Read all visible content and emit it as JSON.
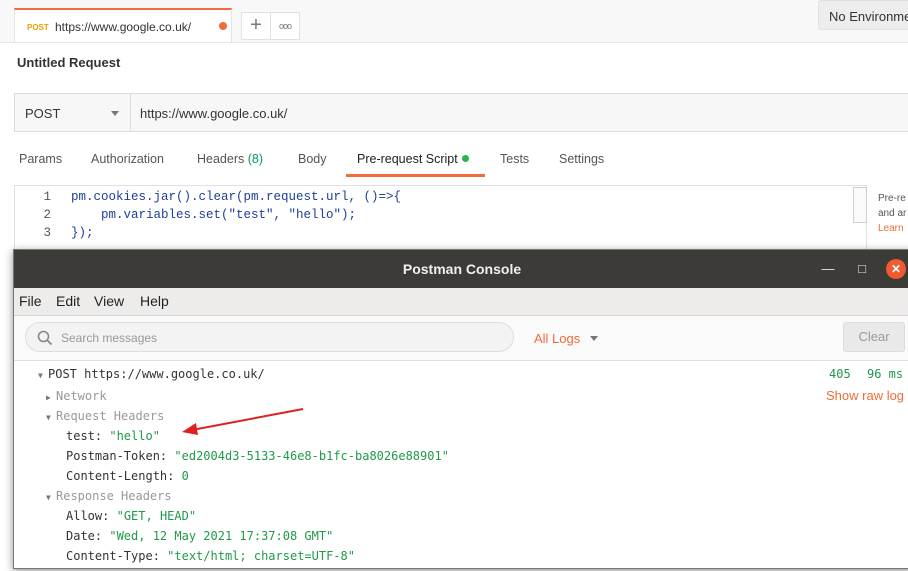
{
  "tab": {
    "method": "POST",
    "url": "https://www.google.co.uk/"
  },
  "tab_buttons": {
    "add": "+",
    "more": "ooo"
  },
  "environment": "No Environment",
  "request": {
    "title": "Untitled Request",
    "method": "POST",
    "url": "https://www.google.co.uk/"
  },
  "subtabs": [
    {
      "label": "Params"
    },
    {
      "label": "Authorization"
    },
    {
      "label": "Headers",
      "count": "(8)"
    },
    {
      "label": "Body"
    },
    {
      "label": "Pre-request Script"
    },
    {
      "label": "Tests"
    },
    {
      "label": "Settings"
    }
  ],
  "editor": {
    "lines": [
      {
        "num": "1",
        "code": "pm.cookies.jar().clear(pm.request.url, ()=>{"
      },
      {
        "num": "2",
        "code": "    pm.variables.set(\"test\", \"hello\");"
      },
      {
        "num": "3",
        "code": "});"
      }
    ]
  },
  "side_help": {
    "line1": "Pre-re",
    "line2": "and ar",
    "link": "Learn"
  },
  "console": {
    "title": "Postman Console",
    "menu": [
      "File",
      "Edit",
      "View",
      "Help"
    ],
    "search_placeholder": "Search messages",
    "filter": "All Logs",
    "clear": "Clear",
    "entry": {
      "summary": "POST https://www.google.co.uk/",
      "status": "405",
      "time": "96 ms",
      "raw_log": "Show raw log",
      "network": "Network",
      "request_headers_label": "Request Headers",
      "request_headers": [
        {
          "key": "test:",
          "value": "\"hello\""
        },
        {
          "key": "Postman-Token:",
          "value": "\"ed2004d3-5133-46e8-b1fc-ba8026e88901\""
        },
        {
          "key": "Content-Length:",
          "value": "0"
        }
      ],
      "response_headers_label": "Response Headers",
      "response_headers": [
        {
          "key": "Allow:",
          "value": "\"GET, HEAD\""
        },
        {
          "key": "Date:",
          "value": "\"Wed, 12 May 2021 17:37:08 GMT\""
        },
        {
          "key": "Content-Type:",
          "value": "\"text/html; charset=UTF-8\""
        }
      ]
    }
  },
  "colors": {
    "accent": "#f26b3a",
    "green": "#1f9a49",
    "titlebar": "#3c3b37",
    "close": "#f05a2f",
    "annotation_arrow": "#e02020"
  }
}
